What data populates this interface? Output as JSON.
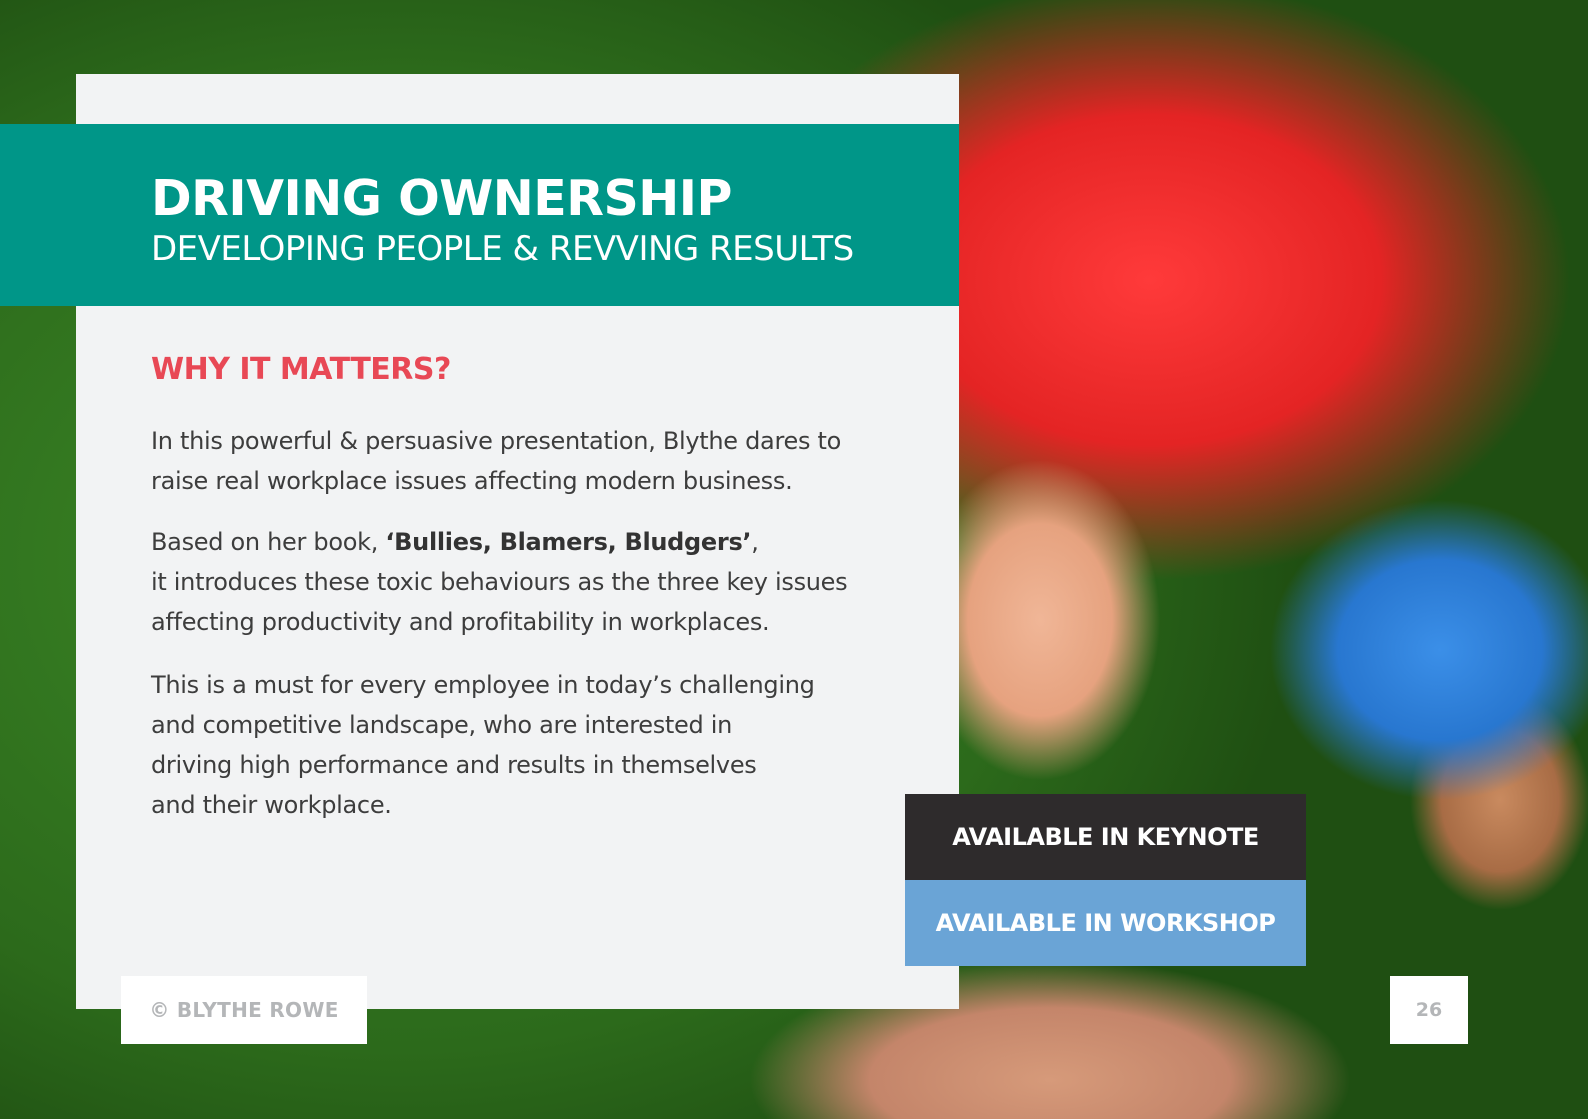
{
  "header": {
    "title": "DRIVING OWNERSHIP",
    "subtitle": "DEVELOPING PEOPLE & REVVING RESULTS"
  },
  "section": {
    "heading": "WHY IT MATTERS?",
    "paragraph_1": [
      "In this powerful & persuasive presentation, Blythe dares to",
      "raise real workplace issues affecting modern business."
    ],
    "paragraph_2": {
      "line_1_prefix": "Based on her book, ",
      "book_title": "‘Bullies, Blamers, Bludgers’",
      "line_1_suffix": ",",
      "line_2": "it introduces these toxic behaviours as the three key issues",
      "line_3": "affecting productivity and profitability in workplaces."
    },
    "paragraph_3": [
      "This is a must for every employee in today’s challenging",
      "and competitive landscape, who are interested in",
      "driving high performance and results in themselves",
      "and their workplace."
    ]
  },
  "buttons": {
    "keynote": "AVAILABLE IN KEYNOTE",
    "workshop": "AVAILABLE IN WORKSHOP"
  },
  "footer": {
    "copyright": "© BLYTHE ROWE",
    "page_number": "26"
  },
  "colors": {
    "title_band": "#009688",
    "heading_accent": "#e84855",
    "keynote_bg": "#2e2b2c",
    "workshop_bg": "#6aa4d6"
  }
}
